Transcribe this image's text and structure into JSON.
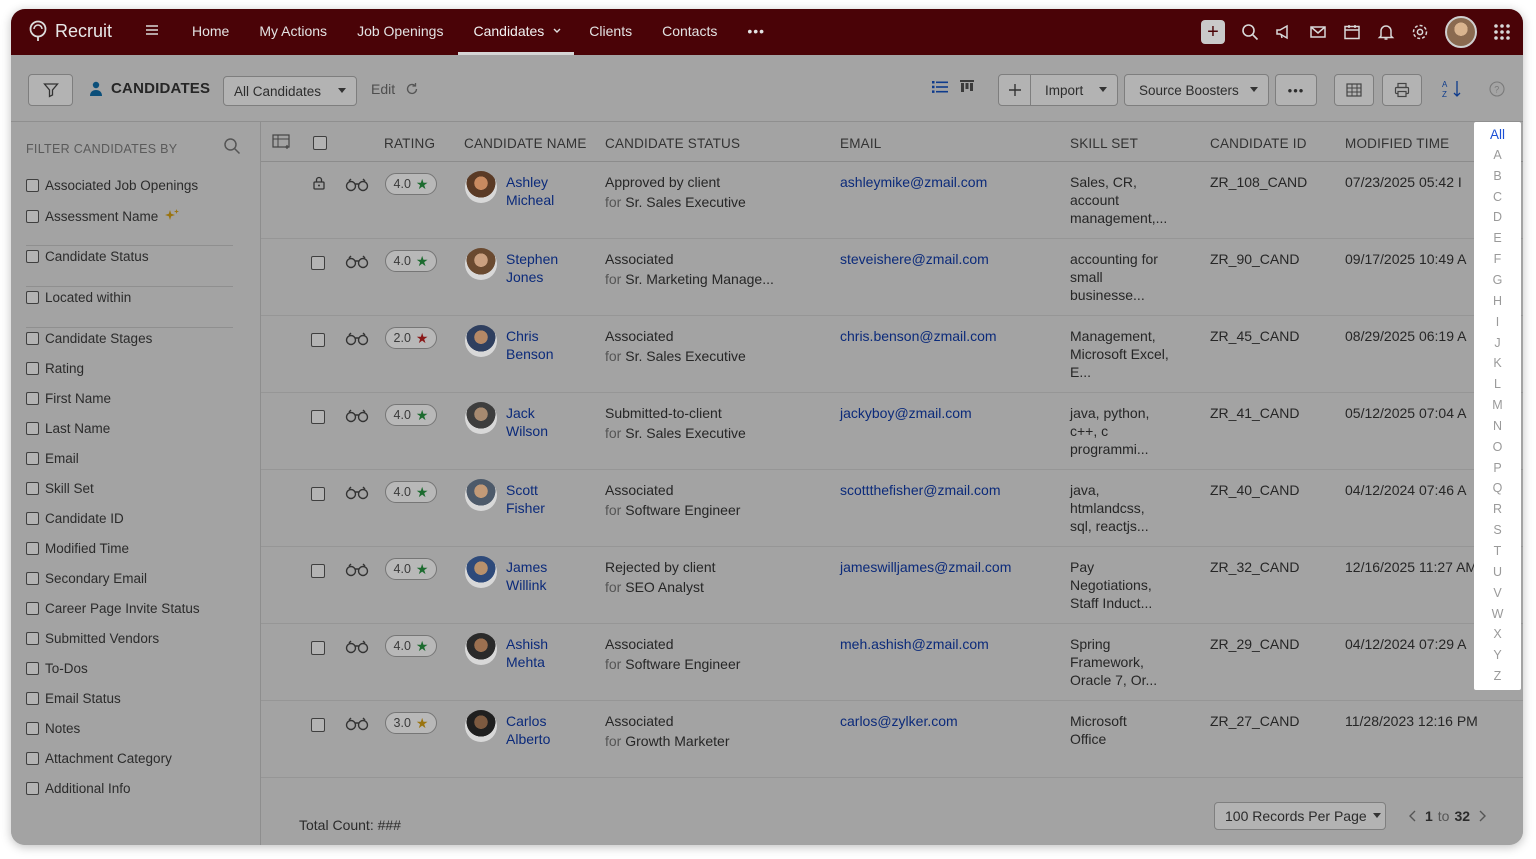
{
  "topbar": {
    "app_name": "Recruit",
    "nav": [
      {
        "label": "Home"
      },
      {
        "label": "My Actions"
      },
      {
        "label": "Job Openings"
      },
      {
        "label": "Candidates",
        "active": true
      },
      {
        "label": "Clients"
      },
      {
        "label": "Contacts"
      },
      {
        "label": "•••"
      }
    ],
    "icons": [
      "plus-icon",
      "search-icon",
      "megaphone-icon",
      "mail-icon",
      "calendar-icon",
      "bell-icon",
      "gear-icon",
      "avatar",
      "apps-grid-icon"
    ]
  },
  "toolbar": {
    "title": "CANDIDATES",
    "view_select": "All Candidates",
    "edit_label": "Edit",
    "import_label": "Import",
    "source_boosters_label": "Source Boosters",
    "more_label": "•••"
  },
  "sidebar": {
    "header": "FILTER CANDIDATES BY",
    "filters": [
      "Associated Job Openings",
      "Assessment Name",
      "Candidate Status",
      "Located within",
      "Candidate Stages",
      "Rating",
      "First Name",
      "Last Name",
      "Email",
      "Skill Set",
      "Candidate ID",
      "Modified Time",
      "Secondary Email",
      "Career Page Invite Status",
      "Submitted Vendors",
      "To-Dos",
      "Email Status",
      "Notes",
      "Attachment Category",
      "Additional Info"
    ]
  },
  "table": {
    "headers": {
      "rating": "RATING",
      "name": "CANDIDATE NAME",
      "status": "CANDIDATE STATUS",
      "email": "EMAIL",
      "skills": "SKILL SET",
      "id": "CANDIDATE ID",
      "modified": "MODIFIED TIME"
    },
    "rows": [
      {
        "first": "Ashley",
        "last": "Micheal",
        "rating": "4.0",
        "star": "green",
        "status": "Approved by client",
        "for_prefix": "for",
        "job": "Sr. Sales Executive",
        "email": "ashleymike@zmail.com",
        "skills": [
          "Sales, CR,",
          "account",
          "management,..."
        ],
        "id": "ZR_108_CAND",
        "modified": "07/23/2025 05:42 I",
        "locked": true
      },
      {
        "first": "Stephen",
        "last": "Jones",
        "rating": "4.0",
        "star": "green",
        "status": "Associated",
        "for_prefix": "for",
        "job": "Sr. Marketing Manage...",
        "email": "steveishere@zmail.com",
        "skills": [
          "accounting for",
          "small",
          "businesse..."
        ],
        "id": "ZR_90_CAND",
        "modified": "09/17/2025 10:49 A",
        "locked": false
      },
      {
        "first": "Chris",
        "last": "Benson",
        "rating": "2.0",
        "star": "red",
        "status": "Associated",
        "for_prefix": "for",
        "job": "Sr. Sales Executive",
        "email": "chris.benson@zmail.com",
        "skills": [
          "Management,",
          "Microsoft Excel,",
          "E..."
        ],
        "id": "ZR_45_CAND",
        "modified": "08/29/2025 06:19 A",
        "locked": false
      },
      {
        "first": "Jack",
        "last": "Wilson",
        "rating": "4.0",
        "star": "green",
        "status": "Submitted-to-client",
        "for_prefix": "for",
        "job": "Sr. Sales Executive",
        "email": "jackyboy@zmail.com",
        "skills": [
          "java, python,",
          "c++, c",
          "programmi..."
        ],
        "id": "ZR_41_CAND",
        "modified": "05/12/2025 07:04 A",
        "locked": false
      },
      {
        "first": "Scott",
        "last": "Fisher",
        "rating": "4.0",
        "star": "green",
        "status": "Associated",
        "for_prefix": "for",
        "job": "Software Engineer",
        "email": "scottthefisher@zmail.com",
        "skills": [
          "java,",
          "htmlandcss,",
          "sql, reactjs..."
        ],
        "id": "ZR_40_CAND",
        "modified": "04/12/2024 07:46 A",
        "locked": false
      },
      {
        "first": "James",
        "last": "Willink",
        "rating": "4.0",
        "star": "green",
        "status": "Rejected by client",
        "for_prefix": "for",
        "job": "SEO Analyst",
        "email": "jameswilljames@zmail.com",
        "skills": [
          "Pay",
          "Negotiations,",
          "Staff Induct..."
        ],
        "id": "ZR_32_CAND",
        "modified": "12/16/2025 11:27 AM",
        "locked": false
      },
      {
        "first": "Ashish",
        "last": "Mehta",
        "rating": "4.0",
        "star": "green",
        "status": "Associated",
        "for_prefix": "for",
        "job": "Software Engineer",
        "email": "meh.ashish@zmail.com",
        "skills": [
          "Spring",
          "Framework,",
          "Oracle 7, Or..."
        ],
        "id": "ZR_29_CAND",
        "modified": "04/12/2024 07:29 A",
        "locked": false
      },
      {
        "first": "Carlos",
        "last": "Alberto",
        "rating": "3.0",
        "star": "yellow",
        "status": "Associated",
        "for_prefix": "for",
        "job": "Growth Marketer",
        "email": "carlos@zylker.com",
        "skills": [
          "Microsoft",
          "Office",
          ""
        ],
        "id": "ZR_27_CAND",
        "modified": "11/28/2023 12:16 PM",
        "locked": false
      }
    ]
  },
  "alphabet": [
    "All",
    "A",
    "B",
    "C",
    "D",
    "E",
    "F",
    "G",
    "H",
    "I",
    "J",
    "K",
    "L",
    "M",
    "N",
    "O",
    "P",
    "Q",
    "R",
    "S",
    "T",
    "U",
    "V",
    "W",
    "X",
    "Y",
    "Z"
  ],
  "footer": {
    "total_count": "Total Count: ###",
    "per_page": "100 Records Per Page",
    "page_current": "1",
    "page_sep": "to",
    "page_total": "32"
  }
}
